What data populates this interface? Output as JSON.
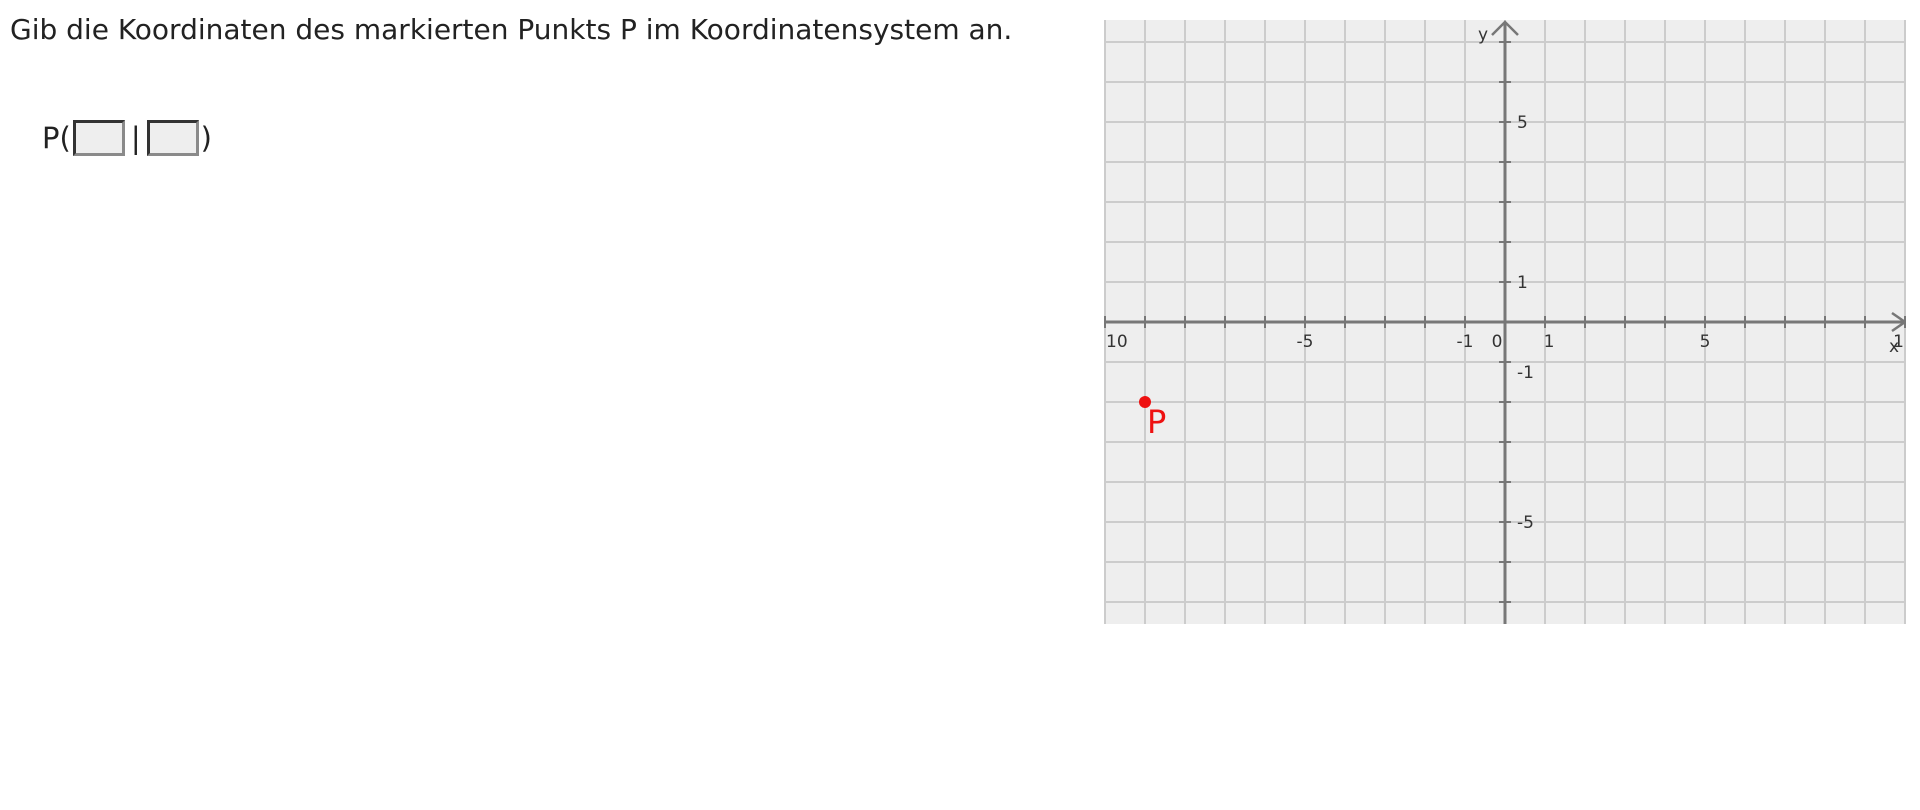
{
  "task": {
    "prompt": "Gib die Koordinaten des markierten Punkts P im Koordinatensystem an."
  },
  "answer": {
    "prefix": "P(",
    "separator": "|",
    "suffix": ")",
    "x_value": "",
    "y_value": ""
  },
  "graph": {
    "background": "#eeeeee",
    "grid_color": "#cccccc",
    "axis_color": "#777777",
    "point_color": "#ee1111",
    "x_axis_label": "x",
    "y_axis_label": "y",
    "x_range": [
      -10,
      10
    ],
    "y_range": [
      -7.5,
      7.5
    ],
    "x_ticks": [
      {
        "v": -10,
        "label": "10"
      },
      {
        "v": -5,
        "label": "-5"
      },
      {
        "v": -1,
        "label": "-1"
      },
      {
        "v": 0,
        "label": "0"
      },
      {
        "v": 1,
        "label": "1"
      },
      {
        "v": 5,
        "label": "5"
      },
      {
        "v": 10,
        "label": "1"
      }
    ],
    "y_ticks": [
      {
        "v": 5,
        "label": "5"
      },
      {
        "v": 1,
        "label": "1"
      },
      {
        "v": -1,
        "label": "-1"
      },
      {
        "v": -5,
        "label": "-5"
      }
    ],
    "point": {
      "label": "P",
      "x": -9,
      "y": -2
    }
  }
}
